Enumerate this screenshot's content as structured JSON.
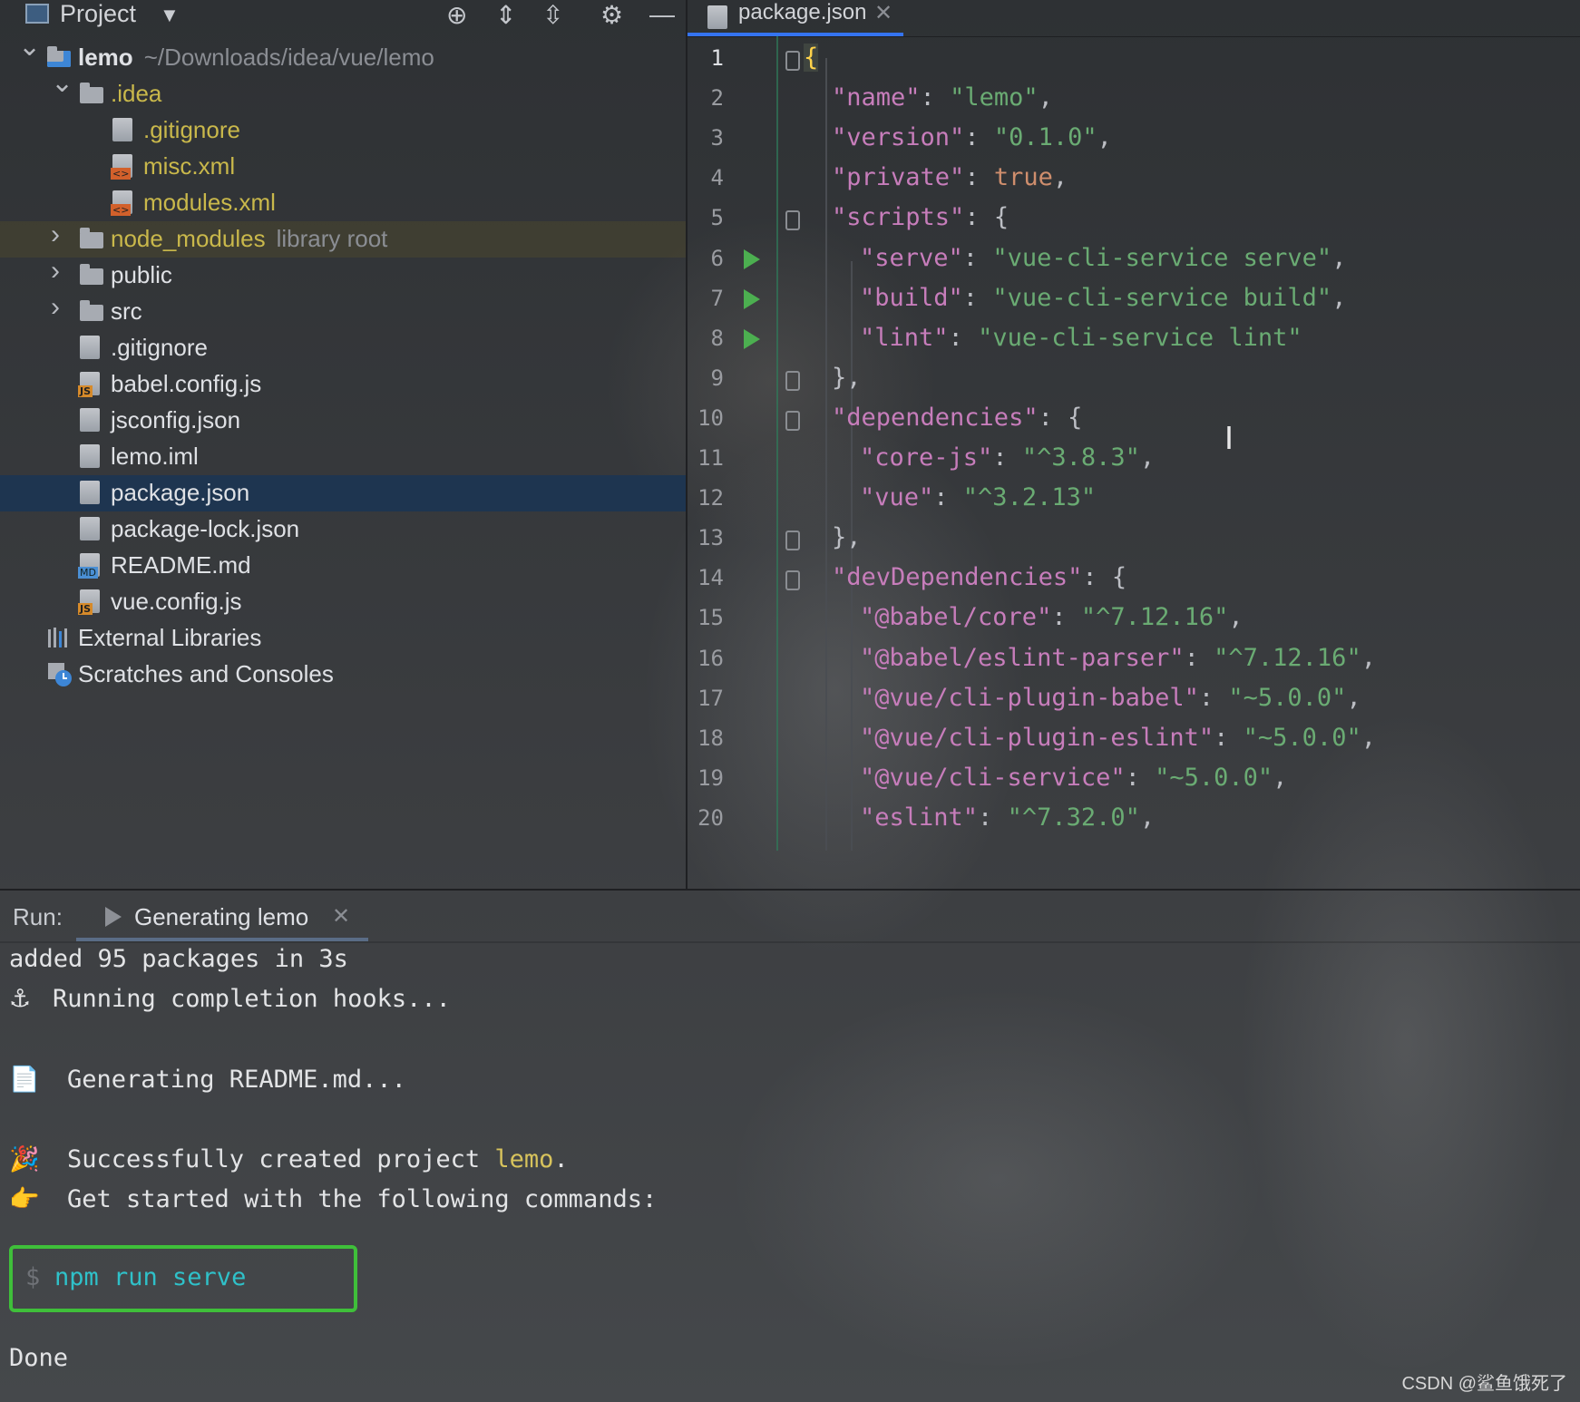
{
  "project_panel": {
    "title": "Project",
    "tree": [
      {
        "name": "lemo",
        "suffix": "~/Downloads/idea/vue/lemo",
        "depth": 0,
        "icon": "module-folder-icon",
        "arrow": "expanded"
      },
      {
        "name": ".idea",
        "depth": 1,
        "icon": "folder-icon",
        "arrow": "expanded",
        "color": "yellow"
      },
      {
        "name": ".gitignore",
        "depth": 2,
        "icon": "ignore-file-icon",
        "color": "yellow"
      },
      {
        "name": "misc.xml",
        "depth": 2,
        "icon": "xml-file-icon",
        "color": "yellow"
      },
      {
        "name": "modules.xml",
        "depth": 2,
        "icon": "xml-file-icon",
        "color": "yellow"
      },
      {
        "name": "node_modules",
        "suffix": "library root",
        "depth": 1,
        "icon": "folder-icon",
        "arrow": "collapsed",
        "color": "yellow"
      },
      {
        "name": "public",
        "depth": 1,
        "icon": "folder-icon",
        "arrow": "collapsed"
      },
      {
        "name": "src",
        "depth": 1,
        "icon": "folder-icon",
        "arrow": "collapsed"
      },
      {
        "name": ".gitignore",
        "depth": 1,
        "icon": "ignore-file-icon"
      },
      {
        "name": "babel.config.js",
        "depth": 1,
        "icon": "js-file-icon"
      },
      {
        "name": "jsconfig.json",
        "depth": 1,
        "icon": "json-file-icon"
      },
      {
        "name": "lemo.iml",
        "depth": 1,
        "icon": "iml-file-icon"
      },
      {
        "name": "package.json",
        "depth": 1,
        "icon": "json-file-icon",
        "selected": true
      },
      {
        "name": "package-lock.json",
        "depth": 1,
        "icon": "json-file-icon"
      },
      {
        "name": "README.md",
        "depth": 1,
        "icon": "md-file-icon"
      },
      {
        "name": "vue.config.js",
        "depth": 1,
        "icon": "js-file-icon"
      },
      {
        "name": "External Libraries",
        "depth": 0,
        "icon": "libraries-icon"
      },
      {
        "name": "Scratches and Consoles",
        "depth": 0,
        "icon": "scratches-icon"
      }
    ]
  },
  "editor": {
    "tab_label": "package.json",
    "lines": [
      {
        "n": "1",
        "fold": true,
        "run": false,
        "indent": 0,
        "parts": [
          {
            "t": "{",
            "c": "brace-hl"
          }
        ]
      },
      {
        "n": "2",
        "indent": 1,
        "parts": [
          {
            "t": "\"name\"",
            "c": "k"
          },
          {
            "t": ": ",
            "c": "p"
          },
          {
            "t": "\"lemo\"",
            "c": "s"
          },
          {
            "t": ",",
            "c": "p"
          }
        ]
      },
      {
        "n": "3",
        "indent": 1,
        "parts": [
          {
            "t": "\"version\"",
            "c": "k"
          },
          {
            "t": ": ",
            "c": "p"
          },
          {
            "t": "\"0.1.0\"",
            "c": "s"
          },
          {
            "t": ",",
            "c": "p"
          }
        ]
      },
      {
        "n": "4",
        "indent": 1,
        "parts": [
          {
            "t": "\"private\"",
            "c": "k"
          },
          {
            "t": ": ",
            "c": "p"
          },
          {
            "t": "true",
            "c": "b"
          },
          {
            "t": ",",
            "c": "p"
          }
        ]
      },
      {
        "n": "5",
        "fold": true,
        "indent": 1,
        "parts": [
          {
            "t": "\"scripts\"",
            "c": "k"
          },
          {
            "t": ": {",
            "c": "p"
          }
        ]
      },
      {
        "n": "6",
        "run": true,
        "indent": 2,
        "parts": [
          {
            "t": "\"serve\"",
            "c": "k"
          },
          {
            "t": ": ",
            "c": "p"
          },
          {
            "t": "\"vue-cli-service serve\"",
            "c": "s"
          },
          {
            "t": ",",
            "c": "p"
          }
        ]
      },
      {
        "n": "7",
        "run": true,
        "indent": 2,
        "parts": [
          {
            "t": "\"build\"",
            "c": "k"
          },
          {
            "t": ": ",
            "c": "p"
          },
          {
            "t": "\"vue-cli-service build\"",
            "c": "s"
          },
          {
            "t": ",",
            "c": "p"
          }
        ]
      },
      {
        "n": "8",
        "run": true,
        "indent": 2,
        "parts": [
          {
            "t": "\"lint\"",
            "c": "k"
          },
          {
            "t": ": ",
            "c": "p"
          },
          {
            "t": "\"vue-cli-service lint\"",
            "c": "s"
          }
        ]
      },
      {
        "n": "9",
        "fold": true,
        "indent": 1,
        "parts": [
          {
            "t": "},",
            "c": "p"
          }
        ]
      },
      {
        "n": "10",
        "fold": true,
        "indent": 1,
        "parts": [
          {
            "t": "\"dependencies\"",
            "c": "k"
          },
          {
            "t": ": {",
            "c": "p"
          }
        ]
      },
      {
        "n": "11",
        "indent": 2,
        "parts": [
          {
            "t": "\"core-js\"",
            "c": "k"
          },
          {
            "t": ": ",
            "c": "p"
          },
          {
            "t": "\"^3.8.3\"",
            "c": "s"
          },
          {
            "t": ",",
            "c": "p"
          }
        ]
      },
      {
        "n": "12",
        "indent": 2,
        "parts": [
          {
            "t": "\"vue\"",
            "c": "k"
          },
          {
            "t": ": ",
            "c": "p"
          },
          {
            "t": "\"^3.2.13\"",
            "c": "s"
          }
        ]
      },
      {
        "n": "13",
        "fold": true,
        "indent": 1,
        "parts": [
          {
            "t": "},",
            "c": "p"
          }
        ]
      },
      {
        "n": "14",
        "fold": true,
        "indent": 1,
        "parts": [
          {
            "t": "\"devDependencies\"",
            "c": "k"
          },
          {
            "t": ": {",
            "c": "p"
          }
        ]
      },
      {
        "n": "15",
        "indent": 2,
        "parts": [
          {
            "t": "\"@babel/core\"",
            "c": "k"
          },
          {
            "t": ": ",
            "c": "p"
          },
          {
            "t": "\"^7.12.16\"",
            "c": "s"
          },
          {
            "t": ",",
            "c": "p"
          }
        ]
      },
      {
        "n": "16",
        "indent": 2,
        "parts": [
          {
            "t": "\"@babel/eslint-parser\"",
            "c": "k"
          },
          {
            "t": ": ",
            "c": "p"
          },
          {
            "t": "\"^7.12.16\"",
            "c": "s"
          },
          {
            "t": ",",
            "c": "p"
          }
        ]
      },
      {
        "n": "17",
        "indent": 2,
        "parts": [
          {
            "t": "\"@vue/cli-plugin-babel\"",
            "c": "k"
          },
          {
            "t": ": ",
            "c": "p"
          },
          {
            "t": "\"~5.0.0\"",
            "c": "s"
          },
          {
            "t": ",",
            "c": "p"
          }
        ]
      },
      {
        "n": "18",
        "indent": 2,
        "parts": [
          {
            "t": "\"@vue/cli-plugin-eslint\"",
            "c": "k"
          },
          {
            "t": ": ",
            "c": "p"
          },
          {
            "t": "\"~5.0.0\"",
            "c": "s"
          },
          {
            "t": ",",
            "c": "p"
          }
        ]
      },
      {
        "n": "19",
        "indent": 2,
        "parts": [
          {
            "t": "\"@vue/cli-service\"",
            "c": "k"
          },
          {
            "t": ": ",
            "c": "p"
          },
          {
            "t": "\"~5.0.0\"",
            "c": "s"
          },
          {
            "t": ",",
            "c": "p"
          }
        ]
      },
      {
        "n": "20",
        "indent": 2,
        "parts": [
          {
            "t": "\"eslint\"",
            "c": "k"
          },
          {
            "t": ": ",
            "c": "p"
          },
          {
            "t": "\"^7.32.0\"",
            "c": "s"
          },
          {
            "t": ",",
            "c": "p"
          }
        ]
      }
    ]
  },
  "run_panel": {
    "label": "Run:",
    "tab_label": "Generating lemo",
    "console": {
      "line1": "added 95 packages in 3s",
      "line2_icon": "⚓",
      "line2": "Running completion hooks...",
      "line3_icon": "📄",
      "line3": "Generating README.md...",
      "line4_icon": "🎉",
      "line4_prefix": "Successfully created project ",
      "line4_project": "lemo",
      "line4_suffix": ".",
      "line5_icon": "👉",
      "line5": "Get started with the following commands:",
      "prompt": "$",
      "command": "npm run serve",
      "done": "Done"
    }
  },
  "watermark": "CSDN @鲨鱼饿死了"
}
